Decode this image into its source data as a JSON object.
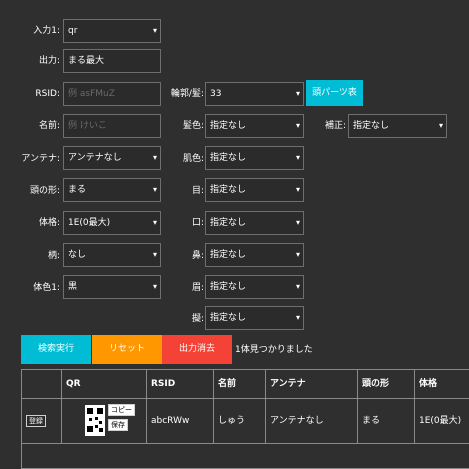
{
  "form": {
    "input1_label": "入力1:",
    "input1_value": "qr",
    "output_label": "出力:",
    "output_value": "まる最大",
    "rsid_label": "RSID:",
    "rsid_placeholder": "例 asFMuZ",
    "name_label": "名前:",
    "name_placeholder": "例 けいこ",
    "antenna_label": "アンテナ:",
    "antenna_value": "アンテナなし",
    "head_label": "頭の形:",
    "head_value": "まる",
    "body_label": "体格:",
    "body_value": "1E(0最大)",
    "pattern_label": "柄:",
    "pattern_value": "なし",
    "color1_label": "体色1:",
    "color1_value": "黒",
    "outline_label": "輪郭/髪:",
    "outline_value": "33",
    "head_parts_button": "頭パーツ表",
    "hair_color_label": "髪色:",
    "hair_color_value": "指定なし",
    "correction_label": "補正:",
    "correction_value": "指定なし",
    "cheek_color_label": "肌色:",
    "cheek_color_value": "指定なし",
    "eye_label": "目:",
    "eye_value": "指定なし",
    "mouth_label": "口:",
    "mouth_value": "指定なし",
    "nose_label": "鼻:",
    "nose_value": "指定なし",
    "eyebrow_label": "眉:",
    "eyebrow_value": "指定なし",
    "accessory_label": "擬:",
    "accessory_value": "指定なし"
  },
  "actions": {
    "search": "検索実行",
    "reset": "リセット",
    "clear_output": "出力消去",
    "status": "1体見つかりました"
  },
  "colors": {
    "search": "#00bcd4",
    "reset": "#ff9800",
    "clear": "#f44336",
    "head_parts": "#00bcd4"
  },
  "table": {
    "headers": [
      "",
      "QR",
      "RSID",
      "名前",
      "アンテナ",
      "頭の形",
      "体格"
    ],
    "row": {
      "register": "登録",
      "copy": "コピー",
      "save": "保存",
      "rsid": "abcRWw",
      "name": "しゅう",
      "antenna": "アンテナなし",
      "head": "まる",
      "body": "1E(0最大)"
    }
  }
}
